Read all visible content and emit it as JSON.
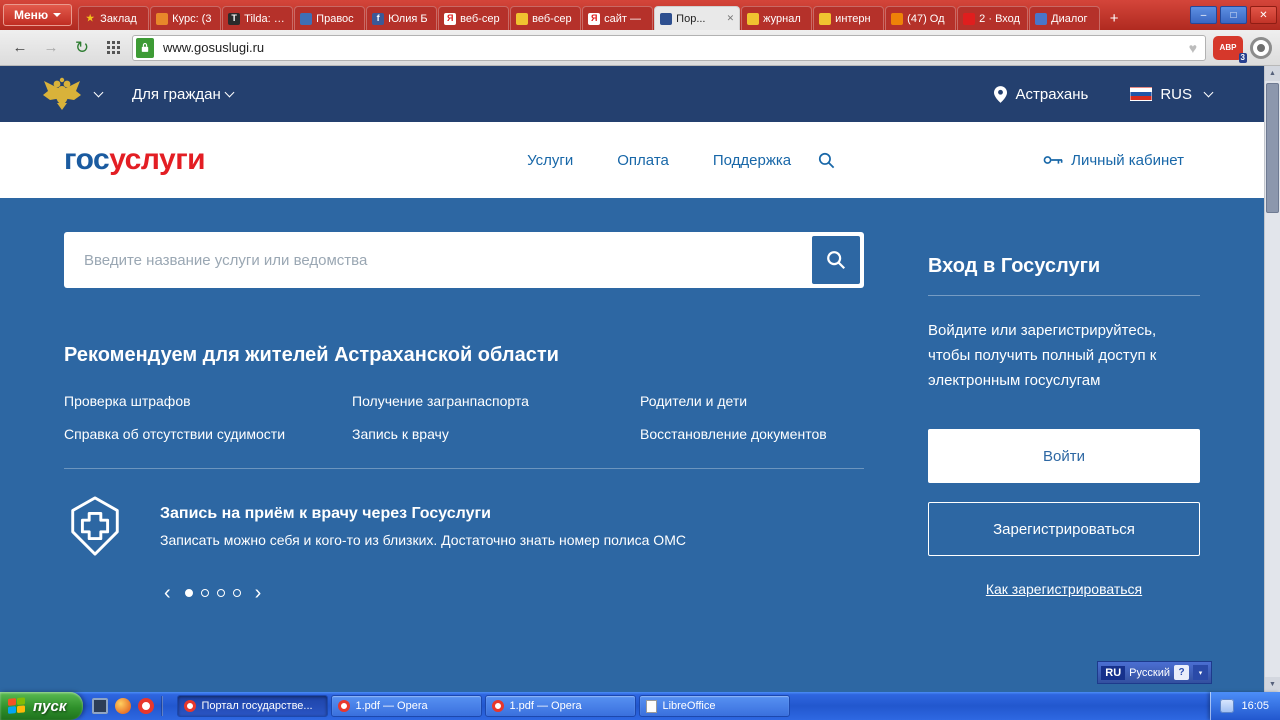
{
  "colors": {
    "site_blue": "#2d67a3",
    "site_navy": "#24406f",
    "logo_blue": "#1b5ba0",
    "logo_red": "#e31e24",
    "browser_red": "#c5332b",
    "taskbar_blue": "#2f62d8",
    "start_green": "#36a035",
    "link_blue": "#1867a8"
  },
  "browser": {
    "menu_label": "Меню",
    "new_tab": "+",
    "window": {
      "minimize": "–",
      "maximize": "□",
      "close": "✕"
    },
    "icons": {
      "back": "←",
      "forward": "→",
      "reload": "↻",
      "heart": "♥",
      "scroll_up": "▲",
      "scroll_down": "▼"
    },
    "address": "www.gosuslugi.ru",
    "adblock": {
      "label": "ABP",
      "badge": "3"
    },
    "tabs": [
      {
        "label": "Заклад",
        "glyph": "★",
        "color": "transparent",
        "fg": "#f3c11b"
      },
      {
        "label": "Курс: (3",
        "glyph": "",
        "color": "#e8872a",
        "fg": "#ffffff"
      },
      {
        "label": "Tilda: CV",
        "glyph": "T",
        "color": "#2b2b2b",
        "fg": "#ffffff"
      },
      {
        "label": "Правос",
        "glyph": "",
        "color": "#3f6fb5",
        "fg": "#ffffff"
      },
      {
        "label": "Юлия Б",
        "glyph": "f",
        "color": "#3b5998",
        "fg": "#ffffff"
      },
      {
        "label": "веб-сер",
        "glyph": "Я",
        "color": "#ffffff",
        "fg": "#e01e1e"
      },
      {
        "label": "веб-сер",
        "glyph": "",
        "color": "#f0c330",
        "fg": "#7a5c00"
      },
      {
        "label": "сайт —",
        "glyph": "Я",
        "color": "#ffffff",
        "fg": "#e01e1e"
      },
      {
        "label": "Пор...",
        "glyph": "",
        "color": "#2d4f8f",
        "fg": "#ffffff"
      },
      {
        "label": "журнал",
        "glyph": "",
        "color": "#f0c330",
        "fg": "#7a5c00"
      },
      {
        "label": "интерн",
        "glyph": "",
        "color": "#f0c330",
        "fg": "#7a5c00"
      },
      {
        "label": "(47) Од",
        "glyph": "",
        "color": "#ee8208",
        "fg": "#ffffff"
      },
      {
        "label": "2 · Вход",
        "glyph": "",
        "color": "#e01e1e",
        "fg": "#ffffff"
      },
      {
        "label": "Диалог",
        "glyph": "",
        "color": "#4a76c8",
        "fg": "#ffffff"
      }
    ]
  },
  "site": {
    "topbar": {
      "audience_label": "Для граждан",
      "city": "Астрахань",
      "language": "RUS"
    },
    "header": {
      "logo_part1": "гос",
      "logo_part2": "услуги",
      "nav": [
        {
          "label": "Услуги"
        },
        {
          "label": "Оплата"
        },
        {
          "label": "Поддержка"
        }
      ],
      "account_label": "Личный кабинет"
    },
    "search_placeholder": "Введите название услуги или ведомства",
    "recommend_title": "Рекомендуем для жителей Астраханской области",
    "services": [
      {
        "label": "Проверка штрафов"
      },
      {
        "label": "Получение загранпаспорта"
      },
      {
        "label": "Родители и дети"
      },
      {
        "label": "Справка об отсутствии судимости"
      },
      {
        "label": "Запись к врачу"
      },
      {
        "label": "Восстановление документов"
      }
    ],
    "banner": {
      "title": "Запись на приём к врачу через Госуслуги",
      "text": "Записать можно себя и кого-то из близких. Достаточно знать номер полиса ОМС"
    },
    "carousel": {
      "prev": "‹",
      "next": "›"
    },
    "login": {
      "title": "Вход в Госуслуги",
      "text": "Войдите или зарегистрируйтесь, чтобы получить полный доступ к электронным госуслугам",
      "login_button": "Войти",
      "register_button": "Зарегистрироваться",
      "how_link": "Как зарегистрироваться"
    }
  },
  "langbar": {
    "code": "RU",
    "label": "Русский",
    "help": "?"
  },
  "taskbar": {
    "start_label": "пуск",
    "tasks": [
      {
        "label": "Портал государстве...",
        "icon": "opera",
        "active": true
      },
      {
        "label": "1.pdf — Opera",
        "icon": "opera"
      },
      {
        "label": "1.pdf — Opera",
        "icon": "opera"
      },
      {
        "label": "LibreOffice",
        "icon": "libreoffice"
      }
    ],
    "clock": "16:05"
  }
}
